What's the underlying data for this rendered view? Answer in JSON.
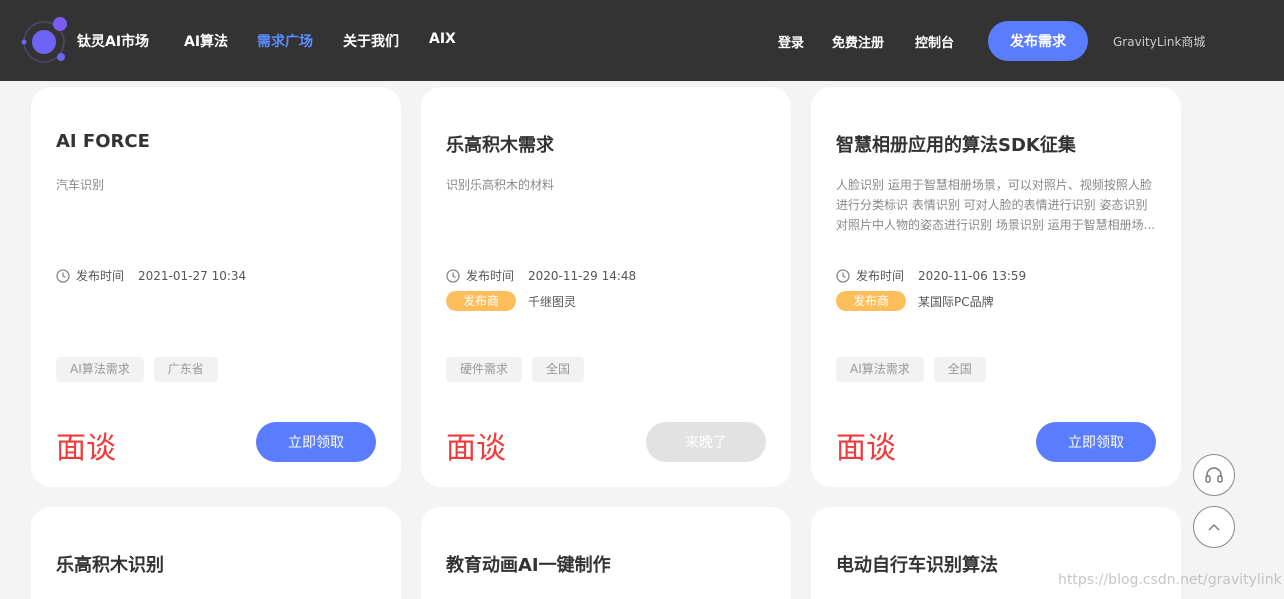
{
  "header": {
    "brand": "钛灵AI市场",
    "nav": [
      "AI算法",
      "需求广场",
      "关于我们",
      "AIX"
    ],
    "active_nav": "需求广场",
    "login": "登录",
    "register": "免费注册",
    "console": "控制台",
    "publish": "发布需求",
    "mall": "GravityLink商城"
  },
  "labels": {
    "time_label": "发布时间",
    "publisher_badge": "发布商"
  },
  "cards": [
    {
      "title": "AI FORCE",
      "desc": "汽车识别",
      "time": "2021-01-27 10:34",
      "publisher": "",
      "tags": [
        "AI算法需求",
        "广东省"
      ],
      "price": "面谈",
      "action": "立即领取"
    },
    {
      "title": "乐高积木需求",
      "desc": "识别乐高积木的材料",
      "time": "2020-11-29 14:48",
      "publisher": "千继图灵",
      "tags": [
        "硬件需求",
        "全国"
      ],
      "price": "面谈",
      "action": "来晚了"
    },
    {
      "title": "智慧相册应用的算法SDK征集",
      "desc": "人脸识别 运用于智慧相册场景，可以对照片、视频按照人脸进行分类标识 表情识别 可对人脸的表情进行识别 姿态识别 对照片中人物的姿态进行识别 场景识别 运用于智慧相册场...",
      "time": "2020-11-06 13:59",
      "publisher": "某国际PC品牌",
      "tags": [
        "AI算法需求",
        "全国"
      ],
      "price": "面谈",
      "action": "立即领取"
    },
    {
      "title": "乐高积木识别"
    },
    {
      "title": "教育动画AI一键制作"
    },
    {
      "title": "电动自行车识别算法"
    }
  ],
  "watermark": "https://blog.csdn.net/gravitylink",
  "icons": [
    "logo-icon",
    "clock-icon",
    "headset-icon",
    "arrow-up-icon"
  ],
  "colors": {
    "header_bg": "#333333",
    "accent": "#5a7cff",
    "price": "#f23a3a",
    "badge": "#ffbe5c"
  }
}
